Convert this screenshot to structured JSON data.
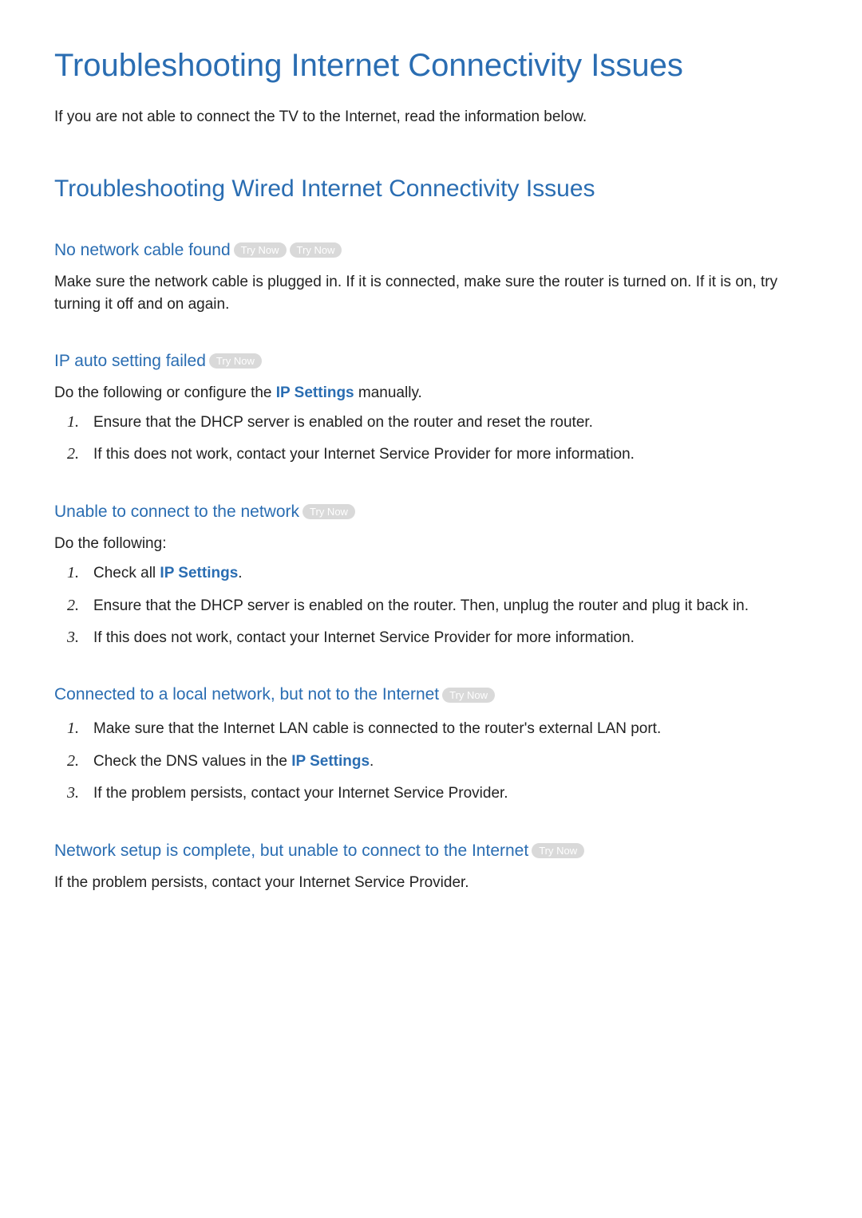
{
  "page_title": "Troubleshooting Internet Connectivity Issues",
  "intro": "If you are not able to connect the TV to the Internet, read the information below.",
  "section_title": "Troubleshooting Wired Internet Connectivity Issues",
  "try_now_label": "Try Now",
  "ip_settings_text": "IP Settings",
  "sub1": {
    "heading": "No network cable found",
    "body": "Make sure the network cable is plugged in. If it is connected, make sure the router is turned on. If it is on, try turning it off and on again."
  },
  "sub2": {
    "heading": "IP auto setting failed",
    "body_pre": "Do the following or configure the ",
    "body_post": " manually.",
    "items": [
      "Ensure that the DHCP server is enabled on the router and reset the router.",
      "If this does not work, contact your Internet Service Provider for more information."
    ]
  },
  "sub3": {
    "heading": "Unable to connect to the network",
    "body": "Do the following:",
    "item1_pre": "Check all ",
    "item1_post": ".",
    "items_rest": [
      "Ensure that the DHCP server is enabled on the router. Then, unplug the router and plug it back in.",
      "If this does not work, contact your Internet Service Provider for more information."
    ]
  },
  "sub4": {
    "heading": "Connected to a local network, but not to the Internet",
    "item1": "Make sure that the Internet LAN cable is connected to the router's external LAN port.",
    "item2_pre": "Check the DNS values in the ",
    "item2_post": ".",
    "item3": "If the problem persists, contact your Internet Service Provider."
  },
  "sub5": {
    "heading": "Network setup is complete, but unable to connect to the Internet",
    "body": "If the problem persists, contact your Internet Service Provider."
  },
  "numbers": {
    "n1": "1.",
    "n2": "2.",
    "n3": "3."
  }
}
